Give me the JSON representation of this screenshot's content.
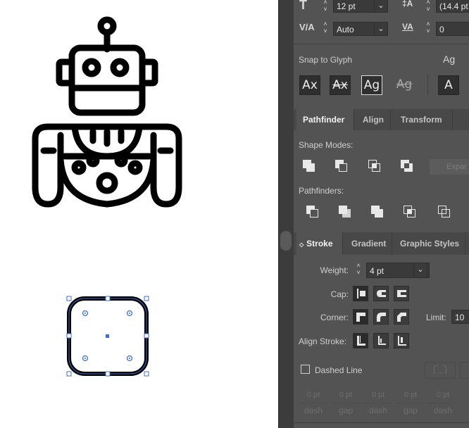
{
  "character": {
    "font_size": "12 pt",
    "leading": "(14.4 pt",
    "kerning": "Auto",
    "tracking": "0"
  },
  "snap": {
    "label": "Snap to Glyph",
    "buttons": [
      "Ax",
      "Ax",
      "Ag",
      "Ag",
      "A"
    ],
    "side_icon": "Ag"
  },
  "pathfinder_panel": {
    "tabs": [
      "Pathfinder",
      "Align",
      "Transform"
    ],
    "shape_modes_label": "Shape Modes:",
    "expand_label": "Expar",
    "pathfinders_label": "Pathfinders:"
  },
  "stroke_panel": {
    "tabs": [
      "Stroke",
      "Gradient",
      "Graphic Styles"
    ],
    "collapse_glyph": "◇",
    "weight_label": "Weight:",
    "weight_value": "4 pt",
    "cap_label": "Cap:",
    "corner_label": "Corner:",
    "limit_label": "Limit:",
    "limit_value": "10",
    "align_label": "Align Stroke:",
    "dashed_label": "Dashed Line",
    "dash_values": [
      "0 pt",
      "0 pt",
      "0 pt",
      "0 pt",
      "0 pt"
    ],
    "dash_labels": [
      "dash",
      "gap",
      "dash",
      "gap",
      "dash"
    ]
  },
  "colors": {
    "panel_bg": "#535353",
    "canvas_bg": "#ffffff",
    "selection": "#3b6fd6",
    "artwork": "#000000"
  }
}
